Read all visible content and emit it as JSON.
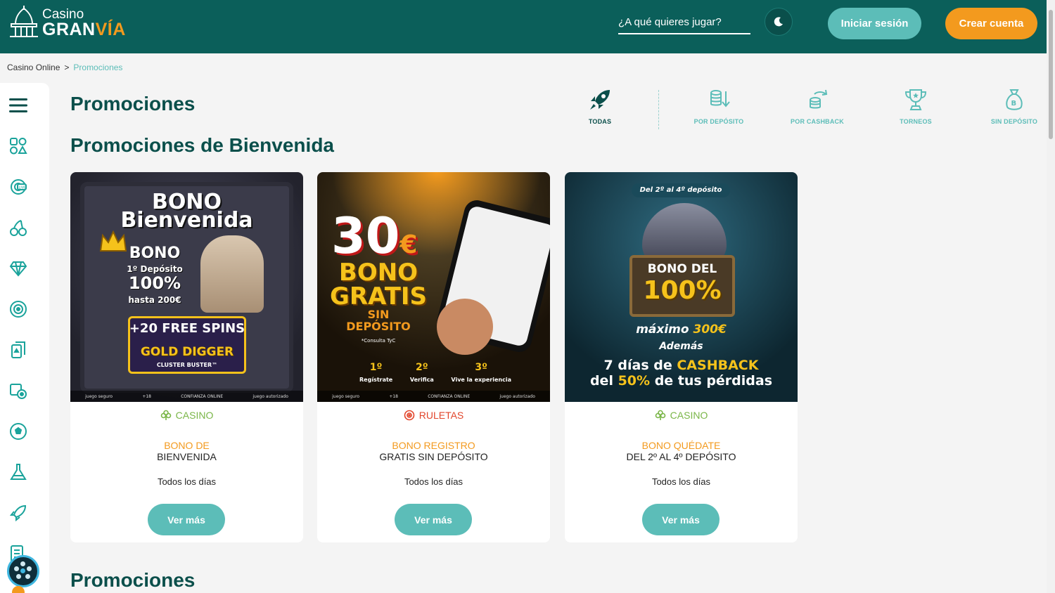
{
  "header": {
    "logo_top": "Casino",
    "logo_main": "GRAN",
    "logo_accent": "VÍA",
    "search_placeholder": "¿A qué quieres jugar?",
    "login_label": "Iniciar sesión",
    "register_label": "Crear cuenta"
  },
  "breadcrumb": {
    "home": "Casino Online",
    "separator": ">",
    "current": "Promociones"
  },
  "page_title": "Promociones",
  "filters": [
    {
      "label": "TODAS",
      "icon": "rocket-icon",
      "active": true
    },
    {
      "label": "POR DEPÓSITO",
      "icon": "coins-deposit-icon",
      "active": false
    },
    {
      "label": "POR CASHBACK",
      "icon": "cashback-icon",
      "active": false
    },
    {
      "label": "TORNEOS",
      "icon": "trophy-icon",
      "active": false
    },
    {
      "label": "SIN DEPÓSITO",
      "icon": "money-bag-icon",
      "active": false
    }
  ],
  "section_welcome": "Promociones de Bienvenida",
  "section_promos": "Promociones",
  "cards": [
    {
      "category": "CASINO",
      "category_color": "#7ab648",
      "title_line1": "BONO DE",
      "title_line2": "BIENVENIDA",
      "when": "Todos los días",
      "button": "Ver más",
      "banner": {
        "l1": "BONO",
        "l2": "Bienvenida",
        "l3": "BONO",
        "l4": "1º Depósito",
        "l5": "100%",
        "l6": "hasta 200€",
        "l7": "+20 FREE SPINS",
        "l8": "GOLD DIGGER",
        "l9": "CLUSTER BUSTER™"
      }
    },
    {
      "category": "RULETAS",
      "category_color": "#e2452b",
      "title_line1": "BONO REGISTRO",
      "title_line2": "GRATIS SIN DEPÓSITO",
      "when": "Todos los días",
      "button": "Ver más",
      "banner": {
        "l1": "30",
        "l1b": "€",
        "l2": "BONO",
        "l3": "GRATIS",
        "l4": "SIN",
        "l5": "DEPÓSITO",
        "l6": "*Consulta TyC",
        "s1": "1º",
        "s1t": "Regístrate",
        "s2": "2º",
        "s2t": "Verifica",
        "s3": "3º",
        "s3t": "Vive la experiencia"
      }
    },
    {
      "category": "CASINO",
      "category_color": "#7ab648",
      "title_line1": "BONO QUÉDATE",
      "title_line2": "DEL 2º AL 4º DEPÓSITO",
      "when": "Todos los días",
      "button": "Ver más",
      "banner": {
        "l0": "Del 2º al 4º depósito",
        "l1": "BONO DEL",
        "l2": "100%",
        "l3": "máximo",
        "l3b": "300€",
        "l4": "Además",
        "l5": "7 días de",
        "l5b": "CASHBACK",
        "l6": "del",
        "l6b": "50%",
        "l6c": "de tus pérdidas"
      }
    }
  ],
  "banner_footer": {
    "a": "juego seguro",
    "b": "+18",
    "c": "CONFIANZA ONLINE",
    "d": "juego autorizado"
  },
  "colors": {
    "header_bg": "#0b5f5a",
    "accent_teal": "#5cbdb8",
    "accent_orange": "#f39a1e",
    "title_color": "#0b4f4b"
  }
}
